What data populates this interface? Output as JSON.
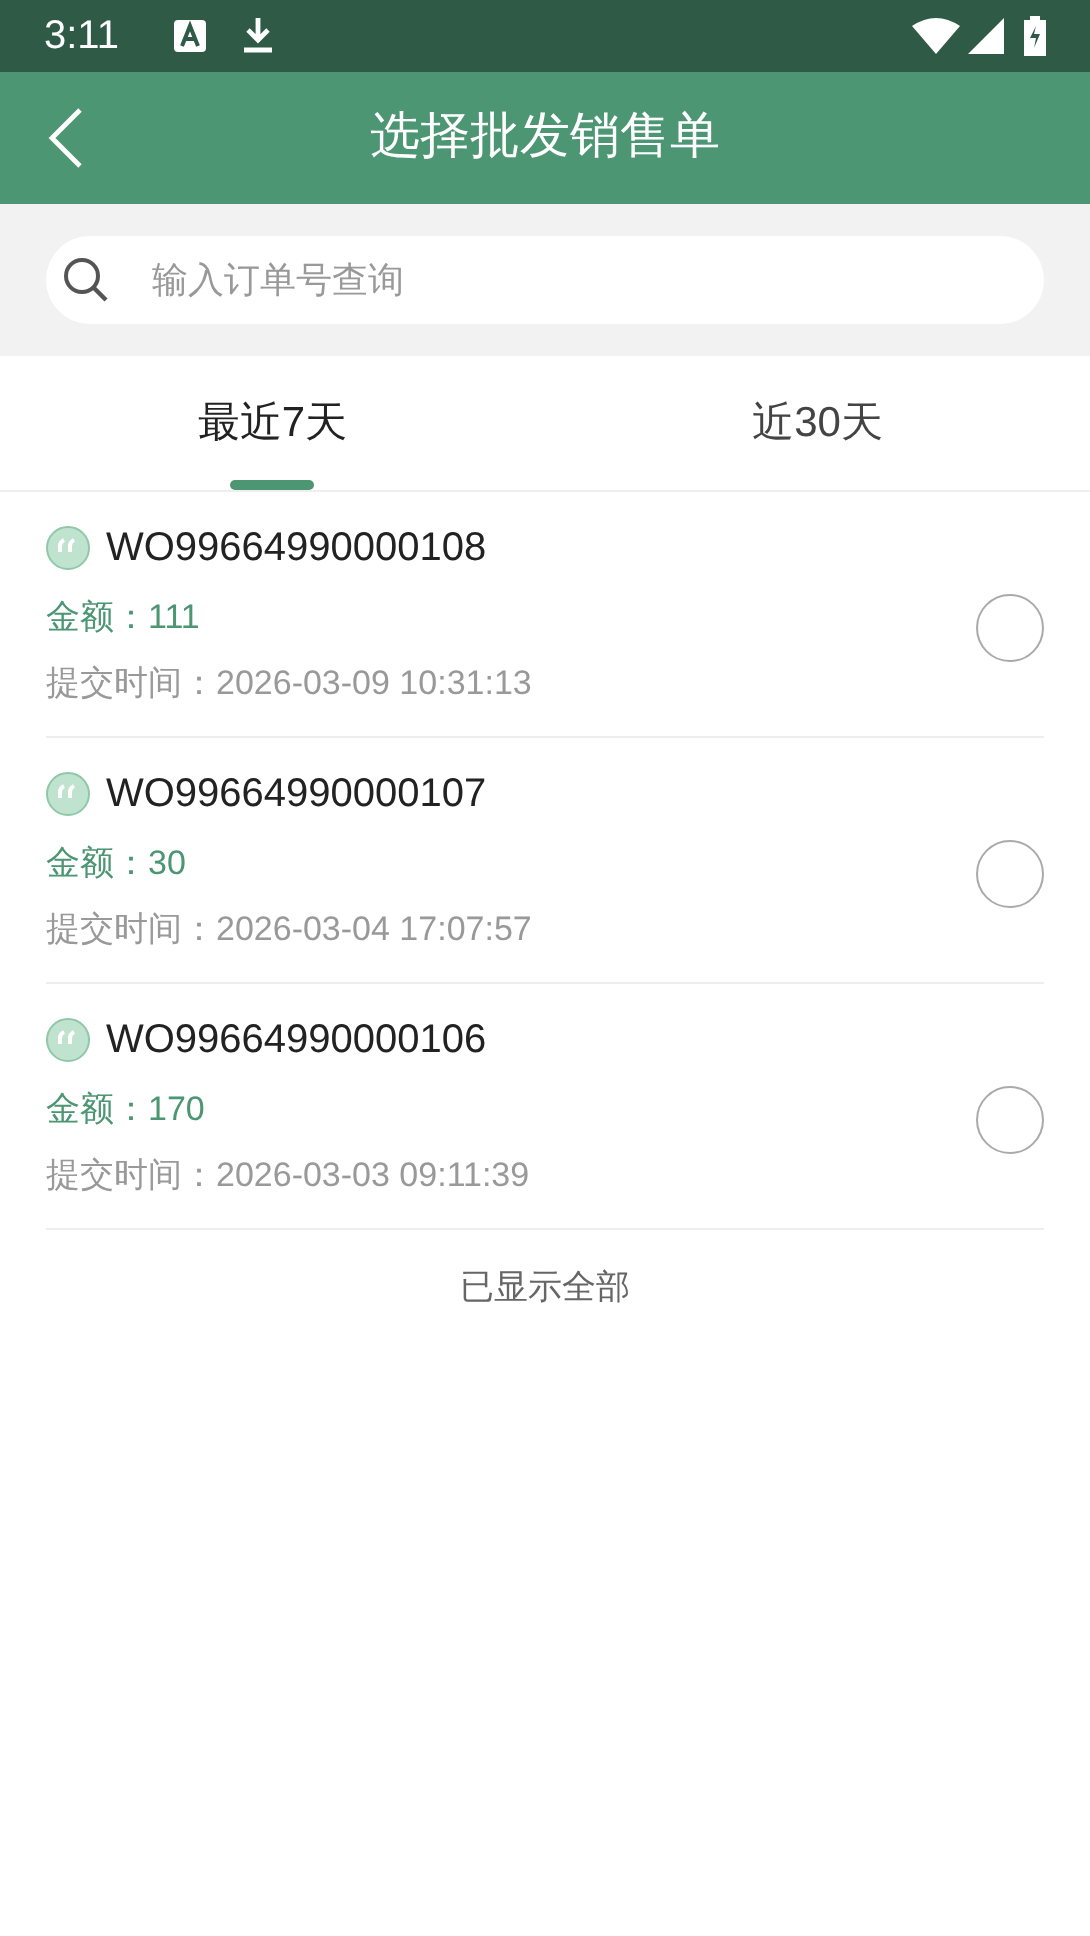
{
  "status_bar": {
    "time": "3:11"
  },
  "header": {
    "title": "选择批发销售单"
  },
  "search": {
    "placeholder": "输入订单号查询"
  },
  "tabs": [
    {
      "label": "最近7天",
      "selected": true
    },
    {
      "label": "近30天",
      "selected": false
    }
  ],
  "orders": [
    {
      "number": "WO99664990000108",
      "amount": "金额：111",
      "time": "提交时间：2026-03-09 10:31:13",
      "selected": false
    },
    {
      "number": "WO99664990000107",
      "amount": "金额：30",
      "time": "提交时间：2026-03-04 17:07:57",
      "selected": false
    },
    {
      "number": "WO99664990000106",
      "amount": "金额：170",
      "time": "提交时间：2026-03-03 09:11:39",
      "selected": false
    }
  ],
  "footer": "已显示全部"
}
